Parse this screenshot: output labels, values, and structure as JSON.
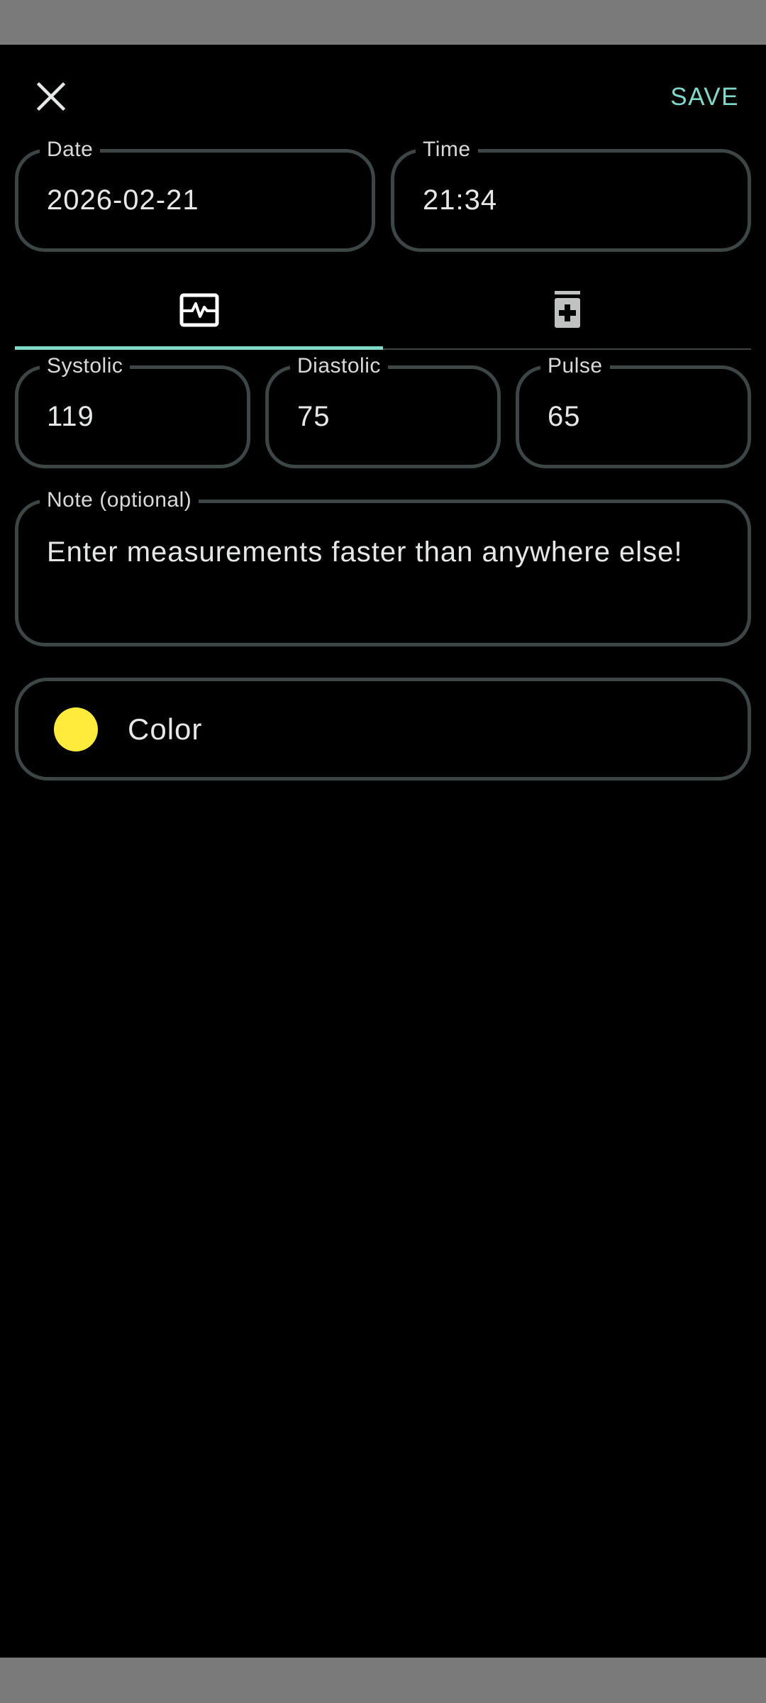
{
  "header": {
    "close_icon": "close-icon",
    "save_label": "SAVE"
  },
  "datetime": {
    "date_label": "Date",
    "date_value": "2026-02-21",
    "time_label": "Time",
    "time_value": "21:34"
  },
  "tabs": [
    {
      "icon": "measurement-waveform-icon",
      "selected": true
    },
    {
      "icon": "medicine-bottle-icon",
      "selected": false
    }
  ],
  "measurements": {
    "systolic_label": "Systolic",
    "systolic_value": "119",
    "diastolic_label": "Diastolic",
    "diastolic_value": "75",
    "pulse_label": "Pulse",
    "pulse_value": "65"
  },
  "note": {
    "label": "Note (optional)",
    "value": "Enter measurements faster than anywhere else!"
  },
  "color": {
    "label": "Color",
    "value": "#ffeb3b"
  },
  "colors": {
    "accent": "#7fd8c8",
    "background": "#000000",
    "outline": "#3d4644",
    "system_bar": "#7a7a7a"
  }
}
